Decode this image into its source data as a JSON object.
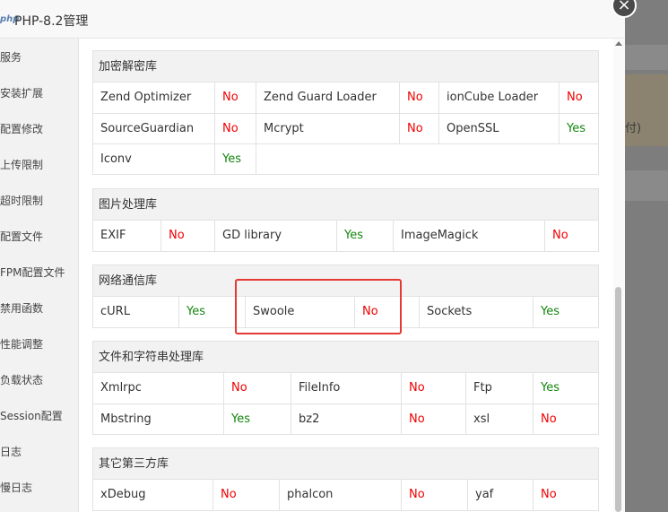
{
  "window": {
    "logo": "php",
    "title": "PHP-8.2管理",
    "close_icon": "×"
  },
  "sidebar": {
    "items": [
      "服务",
      "安装扩展",
      "配置修改",
      "上传限制",
      "超时限制",
      "配置文件",
      "FPM配置文件",
      "禁用函数",
      "性能调整",
      "负载状态",
      "Session配置",
      "日志",
      "慢日志"
    ]
  },
  "backdrop": {
    "partial_text": "付)"
  },
  "sections": [
    {
      "title": "加密解密库",
      "rows": [
        [
          {
            "name": "Zend Optimizer",
            "status": "No"
          },
          {
            "name": "Zend Guard Loader",
            "status": "No"
          },
          {
            "name": "ionCube Loader",
            "status": "No"
          }
        ],
        [
          {
            "name": "SourceGuardian",
            "status": "No"
          },
          {
            "name": "Mcrypt",
            "status": "No"
          },
          {
            "name": "OpenSSL",
            "status": "Yes"
          }
        ],
        [
          {
            "name": "Iconv",
            "status": "Yes"
          }
        ]
      ]
    },
    {
      "title": "图片处理库",
      "rows": [
        [
          {
            "name": "EXIF",
            "status": "No"
          },
          {
            "name": "GD library",
            "status": "Yes"
          },
          {
            "name": "ImageMagick",
            "status": "No"
          }
        ]
      ]
    },
    {
      "title": "网络通信库",
      "rows": [
        [
          {
            "name": "cURL",
            "status": "Yes"
          },
          {
            "name": "Swoole",
            "status": "No"
          },
          {
            "name": "Sockets",
            "status": "Yes"
          }
        ]
      ]
    },
    {
      "title": "文件和字符串处理库",
      "rows": [
        [
          {
            "name": "Xmlrpc",
            "status": "No"
          },
          {
            "name": "FileInfo",
            "status": "No"
          },
          {
            "name": "Ftp",
            "status": "Yes"
          }
        ],
        [
          {
            "name": "Mbstring",
            "status": "Yes"
          },
          {
            "name": "bz2",
            "status": "No"
          },
          {
            "name": "xsl",
            "status": "No"
          }
        ]
      ]
    },
    {
      "title": "其它第三方库",
      "rows": [
        [
          {
            "name": "xDebug",
            "status": "No"
          },
          {
            "name": "phalcon",
            "status": "No"
          },
          {
            "name": "yaf",
            "status": "No"
          }
        ]
      ]
    }
  ],
  "colors": {
    "yes": "#13860e",
    "no": "#f00000",
    "highlight": "#e53935"
  }
}
